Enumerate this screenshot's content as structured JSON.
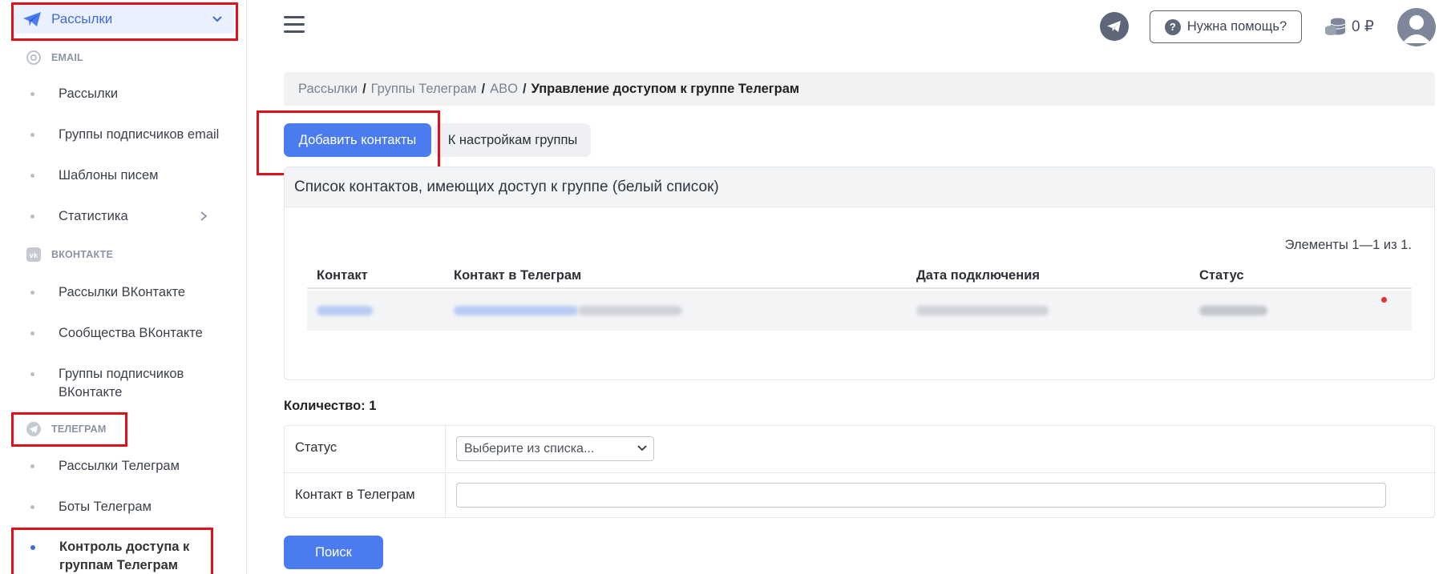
{
  "sidebar": {
    "top": {
      "label": "Рассылки",
      "icon": "paper-plane-icon"
    },
    "sections": {
      "email": "EMAIL",
      "vk": "ВКОНТАКТЕ",
      "telegram": "ТЕЛЕГРАМ"
    },
    "items": {
      "email_mailings": "Рассылки",
      "email_groups": "Группы подписчиков email",
      "templates": "Шаблоны писем",
      "stats": "Статистика",
      "vk_mailings": "Рассылки ВКонтакте",
      "vk_communities": "Сообщества ВКонтакте",
      "vk_groups_line1": "Группы подписчиков",
      "vk_groups_line2": "ВКонтакте",
      "tg_mailings": "Рассылки Телеграм",
      "tg_bots": "Боты Телеграм",
      "tg_access_line1": "Контроль доступа к",
      "tg_access_line2": "группам Телеграм"
    }
  },
  "header": {
    "help_label": "Нужна помощь?",
    "balance": "0 ₽"
  },
  "breadcrumb": {
    "c1": "Рассылки",
    "c2": "Группы Телеграм",
    "c3": "ABO",
    "current": "Управление доступом к группе Телеграм",
    "sep": "/"
  },
  "actions": {
    "add_contacts": "Добавить контакты",
    "group_settings": "К настройкам группы"
  },
  "panel": {
    "title": "Список контактов, имеющих доступ к группе (белый список)",
    "counter": "Элементы 1—1 из 1.",
    "columns": {
      "contact": "Контакт",
      "telegram_contact": "Контакт в Телеграм",
      "connected_date": "Дата подключения",
      "status": "Статус"
    }
  },
  "filters": {
    "quantity": "Количество: 1",
    "status_label": "Статус",
    "status_placeholder": "Выберите из списка...",
    "telegram_label": "Контакт в Телеграм",
    "search_button": "Поиск"
  },
  "colors": {
    "accent": "#4a7cf0",
    "highlight": "#e0101b",
    "active_nav_bg": "#eaf0fd"
  }
}
